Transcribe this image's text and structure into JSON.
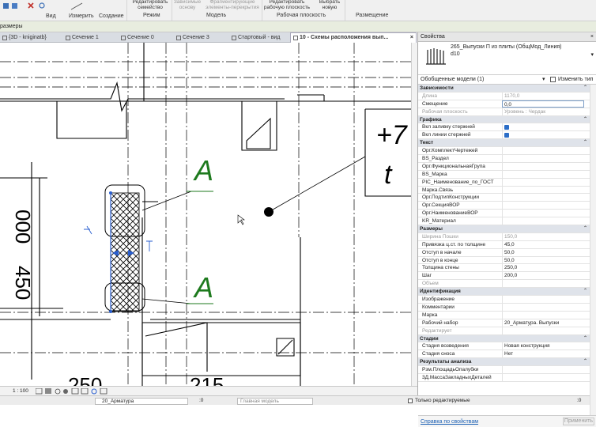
{
  "ribbon": {
    "tools": [
      {
        "label": "Вид"
      },
      {
        "label": "Измерить"
      },
      {
        "label": "Создание"
      }
    ],
    "buttons": [
      {
        "label": "Редактировать\nсемейство",
        "enabled": true
      },
      {
        "label": "Зависимые\nоснову",
        "enabled": false
      },
      {
        "label": "Фрагментирующие\nэлементы-перекрытия",
        "enabled": false
      },
      {
        "label": "Редактировать\nрабочую плоскость",
        "enabled": true
      },
      {
        "label": "Выбрать\nновую",
        "enabled": true
      }
    ],
    "panels": [
      "Режим",
      "Модель",
      "Рабочая плоскость",
      "Размещение"
    ]
  },
  "options_bar": {
    "label": "размеры"
  },
  "tabs": [
    {
      "label": "{3D - kniginatb}",
      "active": false,
      "closable": false
    },
    {
      "label": "Сечение 1",
      "active": false,
      "closable": false
    },
    {
      "label": "Сечение 0",
      "active": false,
      "closable": false
    },
    {
      "label": "Сечение 3",
      "active": false,
      "closable": false
    },
    {
      "label": "Стартовый - вид",
      "active": false,
      "closable": false
    },
    {
      "label": "10 - Схемы расположения вып...",
      "active": true,
      "closable": true
    }
  ],
  "canvas": {
    "labels": [
      {
        "text": "A"
      },
      {
        "text": "A"
      },
      {
        "text": "+7"
      },
      {
        "text": "t"
      },
      {
        "text": "000"
      },
      {
        "text": "450"
      },
      {
        "text": "250"
      },
      {
        "text": "215"
      }
    ]
  },
  "view_bar": {
    "scale": "1 : 100"
  },
  "status_bar": {
    "workset_value": "20_Арматура",
    "sync_value": ":0",
    "model_value": "Главная модель",
    "editable_only": "Только редактируемые",
    "filter_count": ":0"
  },
  "properties": {
    "title": "Свойства",
    "type_name": "265_Выпуски П из плиты (ОбщМод_Линия)",
    "type_subname": "d10",
    "filter_value": "Обобщенные модели (1)",
    "edit_type_label": "Изменить тип",
    "rows": [
      {
        "kind": "section",
        "key": "Зависимости",
        "value": ""
      },
      {
        "kind": "grey",
        "key": "Длина",
        "value": "1170,0"
      },
      {
        "kind": "input",
        "key": "Смещение",
        "value": "0,0"
      },
      {
        "kind": "grey",
        "key": "Рабочая плоскость",
        "value": "Уровень : Чердак"
      },
      {
        "kind": "section",
        "key": "Графика",
        "value": ""
      },
      {
        "kind": "check",
        "key": "Вкл заливку стержней",
        "value": ""
      },
      {
        "kind": "check",
        "key": "Вкл линии стержней",
        "value": ""
      },
      {
        "kind": "section",
        "key": "Текст",
        "value": ""
      },
      {
        "kind": "row",
        "key": "Орг.КомплектЧертежей",
        "value": ""
      },
      {
        "kind": "row",
        "key": "BS_Раздел",
        "value": ""
      },
      {
        "kind": "row",
        "key": "Орг.ФункциональнаяГрупа",
        "value": ""
      },
      {
        "kind": "row",
        "key": "BS_Марка",
        "value": ""
      },
      {
        "kind": "row",
        "key": "PIC_Наименование_по_ГОСТ",
        "value": ""
      },
      {
        "kind": "row",
        "key": "Марка.Связь",
        "value": ""
      },
      {
        "kind": "row",
        "key": "Орг.ПодтипКонструкции",
        "value": ""
      },
      {
        "kind": "row",
        "key": "Орг.СекцияВОР",
        "value": ""
      },
      {
        "kind": "row",
        "key": "Орг.НаименованиеВОР",
        "value": ""
      },
      {
        "kind": "row",
        "key": "KR_Материал",
        "value": ""
      },
      {
        "kind": "section",
        "key": "Размеры",
        "value": ""
      },
      {
        "kind": "grey",
        "key": "Ширина Пошки",
        "value": "150,0"
      },
      {
        "kind": "row",
        "key": "Привязка ц.ст. по толщине",
        "value": "45,0"
      },
      {
        "kind": "row",
        "key": "Отступ в начале",
        "value": "50,0"
      },
      {
        "kind": "row",
        "key": "Отступ в конце",
        "value": "50,0"
      },
      {
        "kind": "row",
        "key": "Толщина стены",
        "value": "250,0"
      },
      {
        "kind": "row",
        "key": "Шаг",
        "value": "200,0"
      },
      {
        "kind": "grey",
        "key": "Объем",
        "value": ""
      },
      {
        "kind": "section",
        "key": "Идентификация",
        "value": ""
      },
      {
        "kind": "row",
        "key": "Изображение",
        "value": ""
      },
      {
        "kind": "row",
        "key": "Комментарии",
        "value": ""
      },
      {
        "kind": "row",
        "key": "Марка",
        "value": ""
      },
      {
        "kind": "row",
        "key": "Рабочий набор",
        "value": "20_Арматура. Выпуски"
      },
      {
        "kind": "grey",
        "key": "Редактирует",
        "value": ""
      },
      {
        "kind": "section",
        "key": "Стадии",
        "value": ""
      },
      {
        "kind": "row",
        "key": "Стадия возведения",
        "value": "Новая конструкция"
      },
      {
        "kind": "row",
        "key": "Стадия сноса",
        "value": "Нет"
      },
      {
        "kind": "section",
        "key": "Результаты анализа",
        "value": ""
      },
      {
        "kind": "row",
        "key": "Рзм.ПлощадьОпалубки",
        "value": ""
      },
      {
        "kind": "row",
        "key": "3Д.МассаЗакладныхДеталей",
        "value": ""
      }
    ],
    "help_link": "Справка по свойствам",
    "apply_label": "Применить"
  }
}
